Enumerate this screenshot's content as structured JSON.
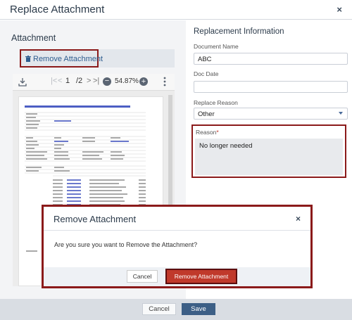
{
  "modal": {
    "title": "Replace Attachment",
    "close_glyph": "×"
  },
  "left": {
    "section_title": "Attachment",
    "remove_button_label": "Remove Attachment",
    "remove_button_icon": "trash-icon"
  },
  "viewer": {
    "page_current": "1",
    "page_total": "/2",
    "zoom": "54.87%",
    "first_glyph": "|<",
    "prev_glyph": "<",
    "next_glyph": ">",
    "last_glyph": ">|",
    "zoom_out_glyph": "−",
    "zoom_in_glyph": "+"
  },
  "right": {
    "section_title": "Replacement Information",
    "document_name_label": "Document Name",
    "document_name_value": "ABC",
    "doc_date_label": "Doc Date",
    "doc_date_value": "",
    "replace_reason_label": "Replace Reason",
    "replace_reason_value": "Other",
    "reason_label": "Reason",
    "reason_required": "*",
    "reason_value": "No longer needed"
  },
  "footer": {
    "cancel_label": "Cancel",
    "save_label": "Save"
  },
  "confirm": {
    "title": "Remove Attachment",
    "close_glyph": "×",
    "message": "Are you sure you want to Remove the Attachment?",
    "cancel_label": "Cancel",
    "confirm_label": "Remove Attachment"
  },
  "colors": {
    "highlight_border": "#8b1a1a",
    "primary": "#3d5f86",
    "danger": "#c0392b"
  }
}
